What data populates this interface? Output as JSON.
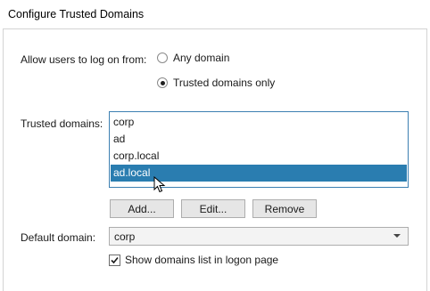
{
  "dialog": {
    "title": "Configure Trusted Domains"
  },
  "logon": {
    "label": "Allow users to log on from:",
    "options": [
      {
        "label": "Any domain",
        "checked": false
      },
      {
        "label": "Trusted domains only",
        "checked": true
      }
    ]
  },
  "trusted": {
    "label": "Trusted domains:",
    "items": [
      {
        "label": "corp",
        "selected": false
      },
      {
        "label": "ad",
        "selected": false
      },
      {
        "label": "corp.local",
        "selected": false
      },
      {
        "label": "ad.local",
        "selected": true
      }
    ],
    "buttons": {
      "add": "Add...",
      "edit": "Edit...",
      "remove": "Remove"
    }
  },
  "default_domain": {
    "label": "Default domain:",
    "value": "corp"
  },
  "show_list": {
    "label": "Show domains list in logon page",
    "checked": true
  },
  "colors": {
    "selection": "#2a7db0",
    "focus_border": "#3c7fb1"
  }
}
